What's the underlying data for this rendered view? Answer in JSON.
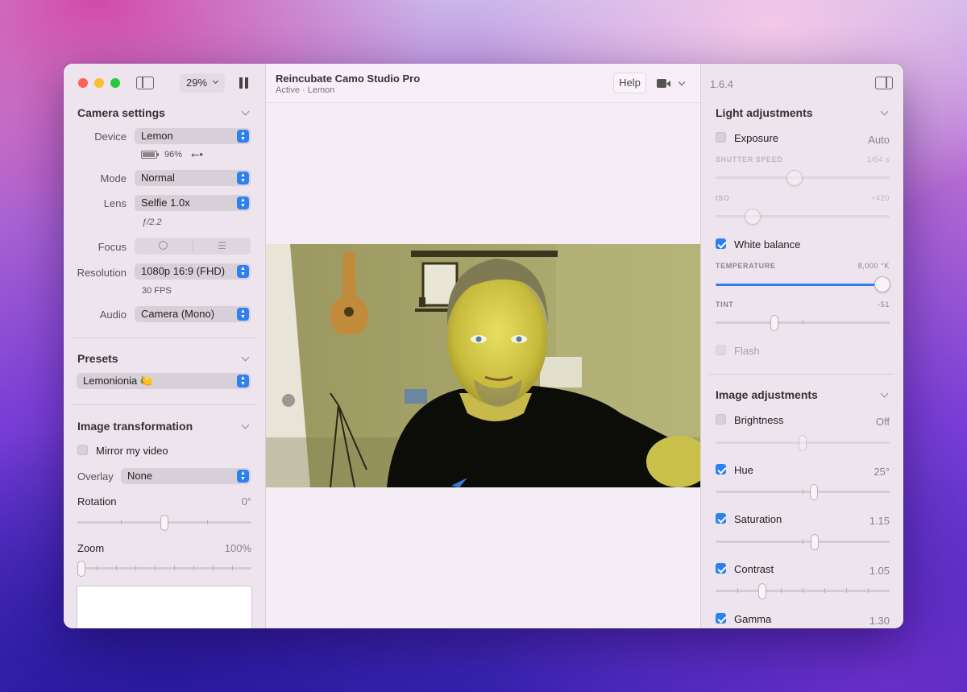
{
  "window": {
    "zoom_label": "29%",
    "title": "Reincubate Camo Studio Pro",
    "subtitle": "Active · Lemon",
    "help_label": "Help",
    "version": "1.6.4"
  },
  "camera_settings": {
    "title": "Camera settings",
    "device": {
      "label": "Device",
      "value": "Lemon"
    },
    "battery": "96%",
    "mode": {
      "label": "Mode",
      "value": "Normal"
    },
    "lens": {
      "label": "Lens",
      "value": "Selfie 1.0x"
    },
    "aperture": "ƒ/2.2",
    "focus": {
      "label": "Focus"
    },
    "resolution": {
      "label": "Resolution",
      "value": "1080p 16:9 (FHD)"
    },
    "fps": "30 FPS",
    "audio": {
      "label": "Audio",
      "value": "Camera (Mono)"
    }
  },
  "presets": {
    "title": "Presets",
    "value": "Lemonionia 🍋"
  },
  "image_transformation": {
    "title": "Image transformation",
    "mirror": {
      "label": "Mirror my video",
      "checked": false
    },
    "overlay": {
      "label": "Overlay",
      "value": "None"
    },
    "rotation": {
      "label": "Rotation",
      "value": "0°",
      "level": 0.5
    },
    "zoom": {
      "label": "Zoom",
      "value": "100%",
      "level": 0.0
    }
  },
  "light_adjustments": {
    "title": "Light adjustments",
    "exposure": {
      "label": "Exposure",
      "value": "Auto",
      "checked": false
    },
    "shutter_speed": {
      "label": "SHUTTER SPEED",
      "value": "1/54 s",
      "level": 0.45
    },
    "iso": {
      "label": "ISO",
      "value": "+420",
      "level": 0.2
    },
    "white_balance": {
      "label": "White balance",
      "checked": true
    },
    "temperature": {
      "label": "TEMPERATURE",
      "value": "8,000 °K",
      "level": 0.96
    },
    "tint": {
      "label": "TINT",
      "value": "-51",
      "level": 0.33
    },
    "flash": {
      "label": "Flash",
      "checked": false
    }
  },
  "image_adjustments": {
    "title": "Image adjustments",
    "brightness": {
      "label": "Brightness",
      "value": "Off",
      "checked": false,
      "level": 0.5
    },
    "hue": {
      "label": "Hue",
      "value": "25°",
      "checked": true,
      "level": 0.56
    },
    "saturation": {
      "label": "Saturation",
      "value": "1.15",
      "checked": true,
      "level": 0.57
    },
    "contrast": {
      "label": "Contrast",
      "value": "1.05",
      "checked": true,
      "level": 0.27
    },
    "gamma": {
      "label": "Gamma",
      "value": "1.30",
      "checked": true
    }
  },
  "colors": {
    "accent": "#2e80f0",
    "close": "#fe5f57",
    "minimize": "#febc2e",
    "zoom": "#28c840"
  }
}
